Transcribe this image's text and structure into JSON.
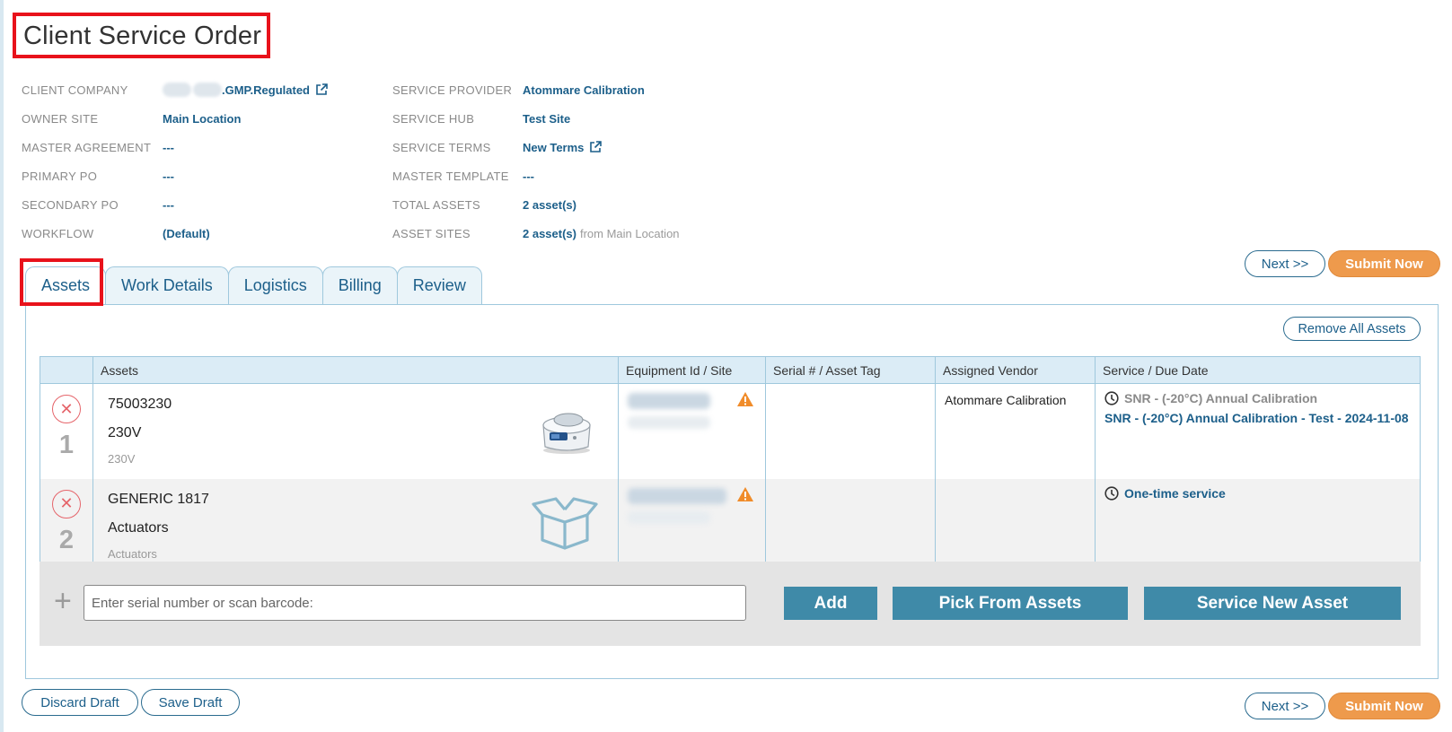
{
  "page": {
    "title": "Client Service Order"
  },
  "meta_left": [
    {
      "label": "CLIENT COMPANY",
      "value": ".GMP.Regulated",
      "link": true,
      "redacted_prefix": true
    },
    {
      "label": "OWNER SITE",
      "value": "Main Location"
    },
    {
      "label": "MASTER AGREEMENT",
      "value": "---"
    },
    {
      "label": "PRIMARY PO",
      "value": "---"
    },
    {
      "label": "SECONDARY PO",
      "value": "---"
    },
    {
      "label": "WORKFLOW",
      "value": "(Default)"
    }
  ],
  "meta_right": [
    {
      "label": "SERVICE PROVIDER",
      "value": "Atommare Calibration"
    },
    {
      "label": "SERVICE HUB",
      "value": "Test Site"
    },
    {
      "label": "SERVICE TERMS",
      "value": "New Terms",
      "link": true
    },
    {
      "label": "MASTER TEMPLATE",
      "value": "---"
    },
    {
      "label": "TOTAL ASSETS",
      "value": "2 asset(s)"
    },
    {
      "label": "ASSET SITES",
      "value": "2 asset(s)",
      "suffix": "from Main Location"
    }
  ],
  "actions": {
    "next": "Next >>",
    "submit": "Submit Now",
    "discard": "Discard Draft",
    "save": "Save Draft",
    "remove_all": "Remove All Assets"
  },
  "tabs": [
    "Assets",
    "Work Details",
    "Logistics",
    "Billing",
    "Review"
  ],
  "table": {
    "columns": [
      "Assets",
      "Equipment Id / Site",
      "Serial # / Asset Tag",
      "Assigned Vendor",
      "Service / Due Date"
    ],
    "rows": [
      {
        "num": "1",
        "remove_icon": "close-icon",
        "name": "75003230",
        "voltage": "230V",
        "sub": "230V",
        "image": "centrifuge-image",
        "serial": "",
        "vendor": "Atommare Calibration",
        "service_title": "SNR - (-20°C) Annual Calibration",
        "service_detail": "SNR - (-20°C) Annual Calibration - Test - 2024-11-08"
      },
      {
        "num": "2",
        "remove_icon": "close-icon",
        "name": "GENERIC 1817",
        "voltage": "Actuators",
        "sub": "Actuators",
        "image": "box-icon",
        "serial": "",
        "vendor": "",
        "service_title": "One-time service",
        "service_detail": ""
      }
    ]
  },
  "add_bar": {
    "placeholder": "Enter serial number or scan barcode:",
    "add": "Add",
    "pick": "Pick From Assets",
    "new_asset": "Service New Asset"
  },
  "colors": {
    "accent": "#1c5f8a",
    "orange": "#ee9a4c",
    "button_blue": "#3f8aa8",
    "highlight_red": "#e8121b",
    "warning": "#f08c2a"
  }
}
